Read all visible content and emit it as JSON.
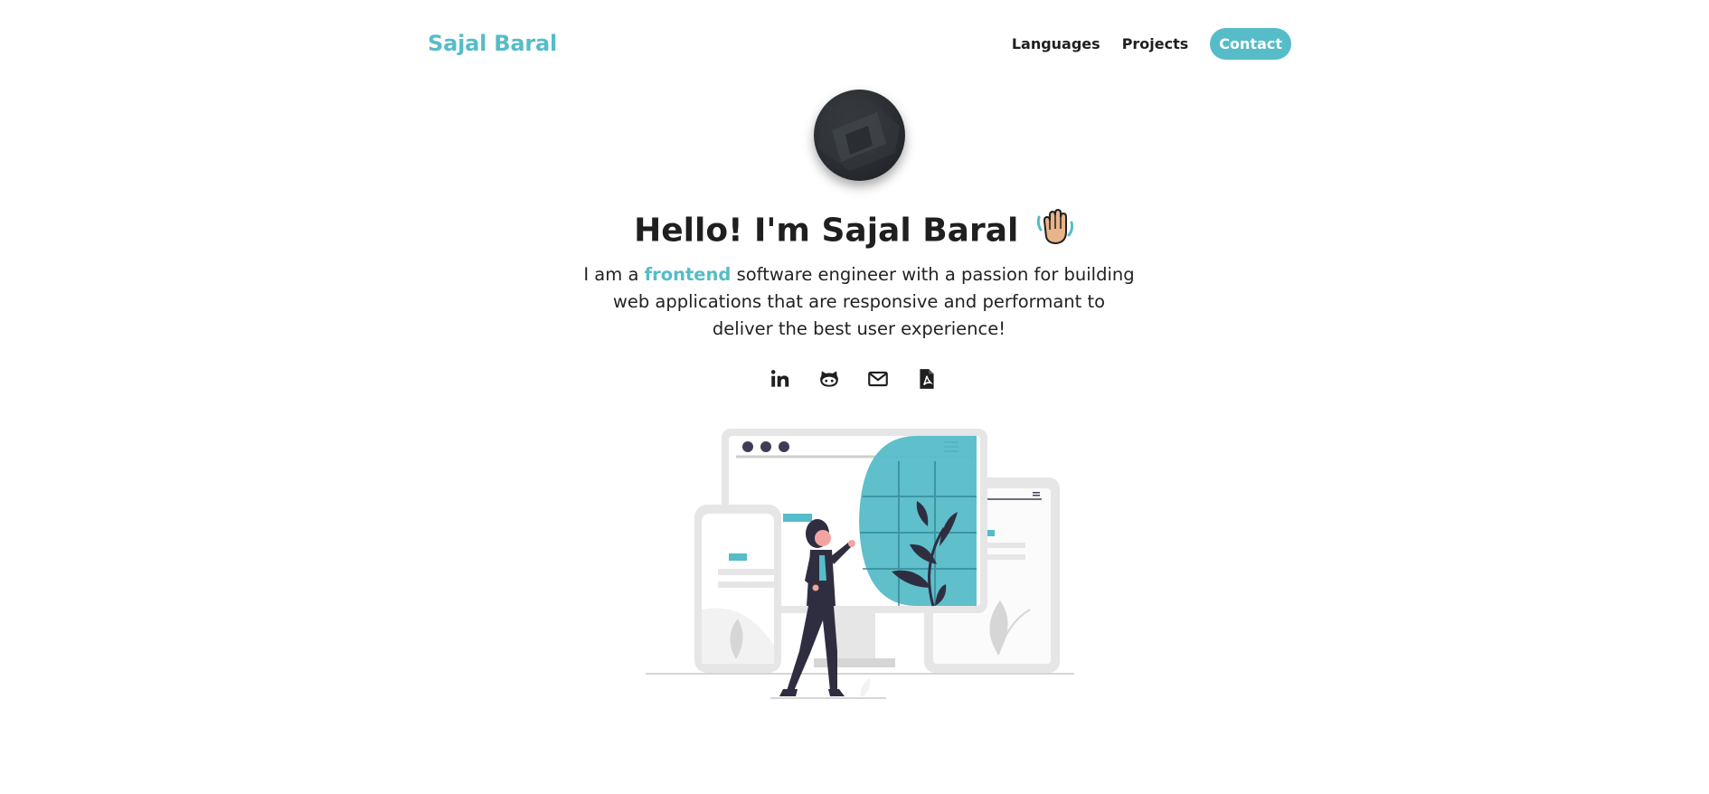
{
  "header": {
    "brand": "Sajal Baral",
    "nav": [
      {
        "label": "Languages"
      },
      {
        "label": "Projects"
      },
      {
        "label": "Contact"
      }
    ]
  },
  "hero": {
    "title": "Hello! I'm Sajal Baral",
    "intro_before": "I am a ",
    "intro_highlight": "frontend",
    "intro_after": " software engineer with a passion for building web applications that are responsive and performant to deliver the best user experience!"
  },
  "socials": [
    {
      "icon": "linkedin-icon"
    },
    {
      "icon": "github-icon"
    },
    {
      "icon": "mail-icon"
    },
    {
      "icon": "pdf-resume-icon"
    }
  ],
  "colors": {
    "accent": "#56bcc8",
    "text": "#1f1f1f",
    "illustration_gray": "#e6e6e6",
    "figure_dark": "#2f2e41"
  }
}
